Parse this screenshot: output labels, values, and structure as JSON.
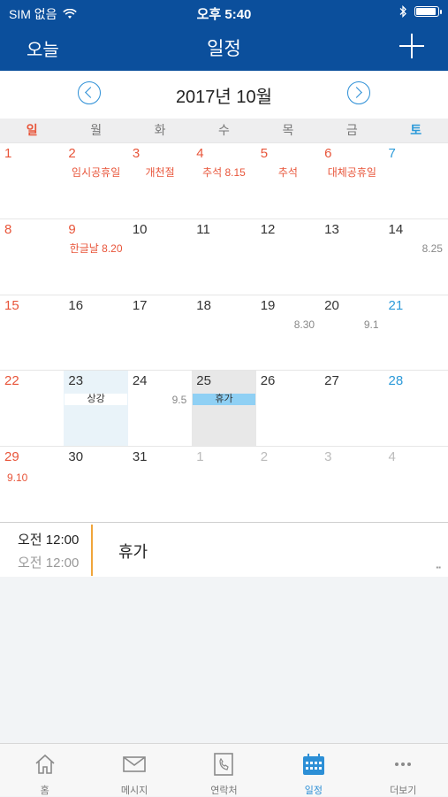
{
  "status": {
    "carrier": "SIM 없음",
    "time": "오후 5:40"
  },
  "nav": {
    "today_label": "오늘",
    "title": "일정"
  },
  "calendar": {
    "month_label": "2017년 10월",
    "weekdays": [
      "일",
      "월",
      "화",
      "수",
      "목",
      "금",
      "토"
    ],
    "weeks": [
      [
        {
          "day": "1",
          "type": "sun"
        },
        {
          "day": "2",
          "type": "sun",
          "holiday": "임시공휴일"
        },
        {
          "day": "3",
          "type": "sun",
          "holiday": "개천절"
        },
        {
          "day": "4",
          "type": "sun",
          "holiday": "추석 8.15"
        },
        {
          "day": "5",
          "type": "sun",
          "holiday": "추석"
        },
        {
          "day": "6",
          "type": "sun",
          "holiday": "대체공휴일"
        },
        {
          "day": "7",
          "type": "sat"
        }
      ],
      [
        {
          "day": "8",
          "type": "sun"
        },
        {
          "day": "9",
          "type": "sun",
          "holiday": "한글날 8.20"
        },
        {
          "day": "10",
          "type": "normal"
        },
        {
          "day": "11",
          "type": "normal"
        },
        {
          "day": "12",
          "type": "normal"
        },
        {
          "day": "13",
          "type": "normal"
        },
        {
          "day": "14",
          "type": "normal",
          "lunar": "8.25"
        }
      ],
      [
        {
          "day": "15",
          "type": "sun"
        },
        {
          "day": "16",
          "type": "normal"
        },
        {
          "day": "17",
          "type": "normal"
        },
        {
          "day": "18",
          "type": "normal"
        },
        {
          "day": "19",
          "type": "normal",
          "lunar": "8.30"
        },
        {
          "day": "20",
          "type": "normal",
          "lunar": "9.1"
        },
        {
          "day": "21",
          "type": "sat"
        }
      ],
      [
        {
          "day": "22",
          "type": "sun"
        },
        {
          "day": "23",
          "type": "normal",
          "highlight": true,
          "event": "상강",
          "event_style": "white"
        },
        {
          "day": "24",
          "type": "normal",
          "lunar": "9.5"
        },
        {
          "day": "25",
          "type": "normal",
          "selected": true,
          "event": "휴가",
          "event_style": "blue"
        },
        {
          "day": "26",
          "type": "normal"
        },
        {
          "day": "27",
          "type": "normal"
        },
        {
          "day": "28",
          "type": "sat"
        }
      ],
      [
        {
          "day": "29",
          "type": "sun",
          "lunar_red": "9.10"
        },
        {
          "day": "30",
          "type": "normal"
        },
        {
          "day": "31",
          "type": "normal"
        },
        {
          "day": "1",
          "type": "dim"
        },
        {
          "day": "2",
          "type": "dim"
        },
        {
          "day": "3",
          "type": "dim"
        },
        {
          "day": "4",
          "type": "dim"
        }
      ]
    ]
  },
  "event_detail": {
    "start": "오전 12:00",
    "end": "오전 12:00",
    "title": "휴가"
  },
  "tabs": [
    {
      "label": "홈",
      "icon": "home-icon",
      "active": false
    },
    {
      "label": "메시지",
      "icon": "mail-icon",
      "active": false
    },
    {
      "label": "연락처",
      "icon": "phone-book-icon",
      "active": false
    },
    {
      "label": "일정",
      "icon": "calendar-icon",
      "active": true
    },
    {
      "label": "더보기",
      "icon": "more-icon",
      "active": false
    }
  ],
  "colors": {
    "brand": "#0b4f9c",
    "accent": "#2c8fd6",
    "sunday": "#e8553a",
    "saturday": "#2c9ad9"
  }
}
